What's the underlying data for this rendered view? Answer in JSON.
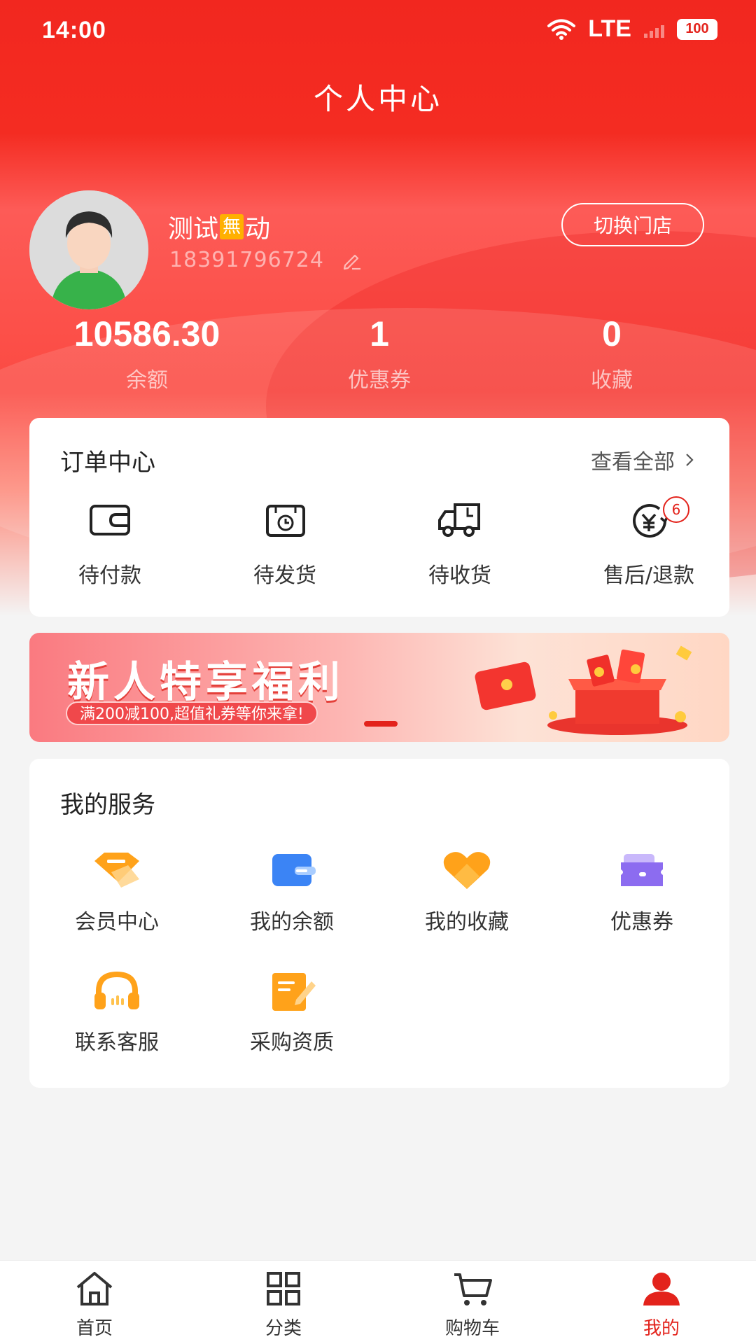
{
  "status_bar": {
    "time": "14:00",
    "network": "LTE",
    "battery": "100"
  },
  "header": {
    "title": "个人中心"
  },
  "profile": {
    "name_prefix": "测试",
    "name_badge": "無",
    "name_suffix": "动",
    "phone": "18391796724",
    "switch_store_label": "切换门店"
  },
  "stats": [
    {
      "value": "10586.30",
      "label": "余额"
    },
    {
      "value": "1",
      "label": "优惠券"
    },
    {
      "value": "0",
      "label": "收藏"
    }
  ],
  "orders": {
    "title": "订单中心",
    "view_all": "查看全部",
    "items": [
      {
        "label": "待付款",
        "icon": "wallet-icon"
      },
      {
        "label": "待发货",
        "icon": "package-clock-icon"
      },
      {
        "label": "待收货",
        "icon": "truck-icon"
      },
      {
        "label": "售后/退款",
        "icon": "refund-icon",
        "badge": "6"
      }
    ]
  },
  "banner": {
    "title": "新人特享福利",
    "subtitle": "满200减100,超值礼券等你来拿!"
  },
  "services": {
    "title": "我的服务",
    "items": [
      {
        "label": "会员中心",
        "icon": "member-card-icon"
      },
      {
        "label": "我的余额",
        "icon": "balance-wallet-icon"
      },
      {
        "label": "我的收藏",
        "icon": "heart-icon"
      },
      {
        "label": "优惠券",
        "icon": "coupon-icon"
      },
      {
        "label": "联系客服",
        "icon": "headset-icon"
      },
      {
        "label": "采购资质",
        "icon": "document-icon"
      }
    ]
  },
  "tabbar": {
    "items": [
      {
        "label": "首页",
        "icon": "home-icon"
      },
      {
        "label": "分类",
        "icon": "grid-icon"
      },
      {
        "label": "购物车",
        "icon": "cart-icon"
      },
      {
        "label": "我的",
        "icon": "user-icon",
        "active": true
      }
    ]
  },
  "colors": {
    "brand_red": "#e3231c",
    "accent_orange": "#ffa21a",
    "accent_blue": "#3b84f5",
    "accent_purple": "#8c6cf0"
  }
}
